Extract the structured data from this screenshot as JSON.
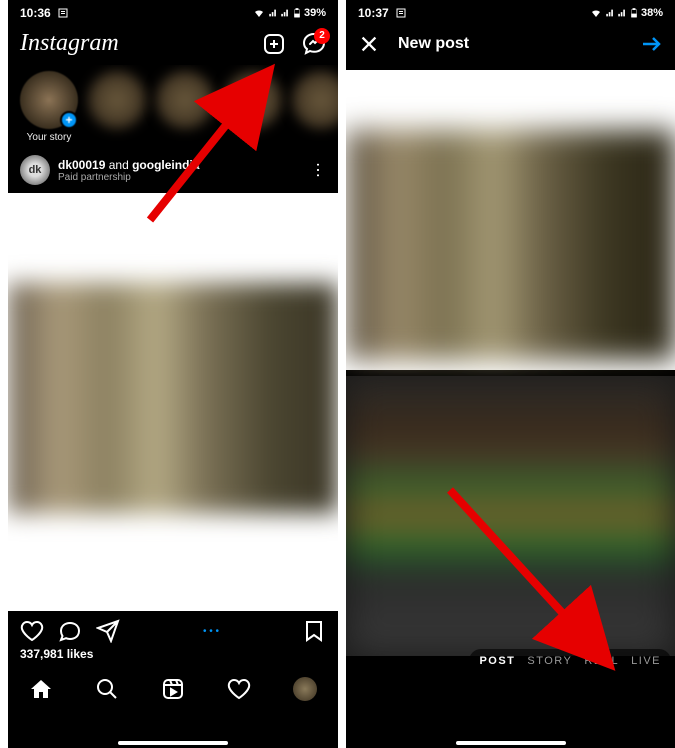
{
  "left": {
    "status": {
      "time": "10:36",
      "battery": "39%"
    },
    "logo": "Instagram",
    "messenger_badge": "2",
    "your_story": "Your story",
    "post": {
      "avatar_initials": "dk",
      "author1": "dk00019",
      "and": "and",
      "author2": "googleindia",
      "subtitle": "Paid partnership",
      "likes": "337,981 likes"
    }
  },
  "right": {
    "status": {
      "time": "10:37",
      "battery": "38%"
    },
    "header": {
      "title": "New post"
    },
    "types": {
      "post": "POST",
      "story": "STORY",
      "reel": "REEL",
      "live": "LIVE"
    }
  }
}
